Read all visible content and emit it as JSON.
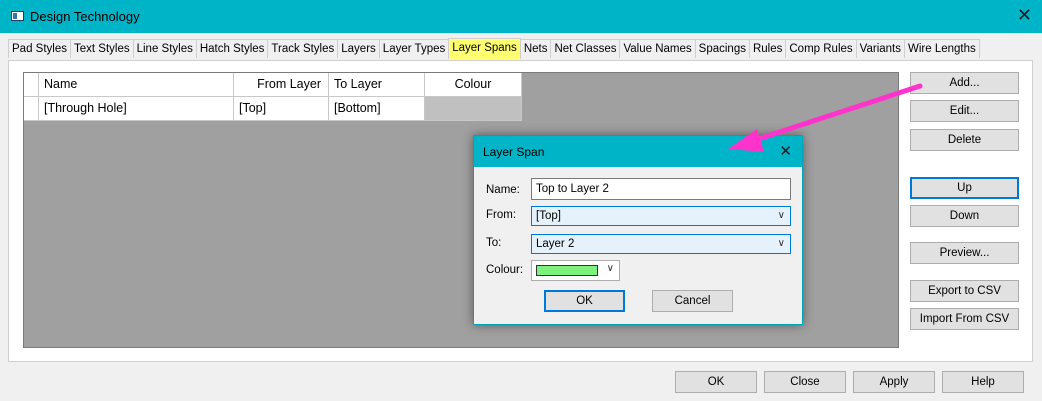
{
  "window": {
    "title": "Design Technology",
    "icon": "app-window-icon",
    "close_icon": "close-icon"
  },
  "tabs": [
    {
      "label": "Pad Styles"
    },
    {
      "label": "Text Styles"
    },
    {
      "label": "Line Styles"
    },
    {
      "label": "Hatch Styles"
    },
    {
      "label": "Track Styles"
    },
    {
      "label": "Layers"
    },
    {
      "label": "Layer Types"
    },
    {
      "label": "Layer Spans",
      "active": true,
      "highlight": "#ffff70"
    },
    {
      "label": "Nets"
    },
    {
      "label": "Net Classes"
    },
    {
      "label": "Value Names"
    },
    {
      "label": "Spacings"
    },
    {
      "label": "Rules"
    },
    {
      "label": "Comp Rules"
    },
    {
      "label": "Variants"
    },
    {
      "label": "Wire Lengths"
    }
  ],
  "grid": {
    "columns": [
      "Name",
      "From Layer",
      "To Layer",
      "Colour"
    ],
    "rows": [
      {
        "name": "[Through Hole]",
        "from": "[Top]",
        "to": "[Bottom]",
        "colour": "#c0c0c0"
      }
    ]
  },
  "side_buttons": {
    "add": "Add...",
    "edit": "Edit...",
    "delete": "Delete",
    "up": "Up",
    "down": "Down",
    "preview": "Preview...",
    "export": "Export to CSV",
    "import": "Import From CSV"
  },
  "bottom_buttons": {
    "ok": "OK",
    "close": "Close",
    "apply": "Apply",
    "help": "Help"
  },
  "dialog": {
    "title": "Layer Span",
    "name_label": "Name:",
    "name_value": "Top to Layer 2",
    "from_label": "From:",
    "from_value": "[Top]",
    "to_label": "To:",
    "to_value": "Layer 2",
    "colour_label": "Colour:",
    "colour_value": "#7cf27c",
    "ok": "OK",
    "cancel": "Cancel"
  },
  "annotation": {
    "arrow_color": "#ff33cc"
  },
  "colors": {
    "titlebar": "#00b4c8",
    "focus": "#0078d7"
  }
}
